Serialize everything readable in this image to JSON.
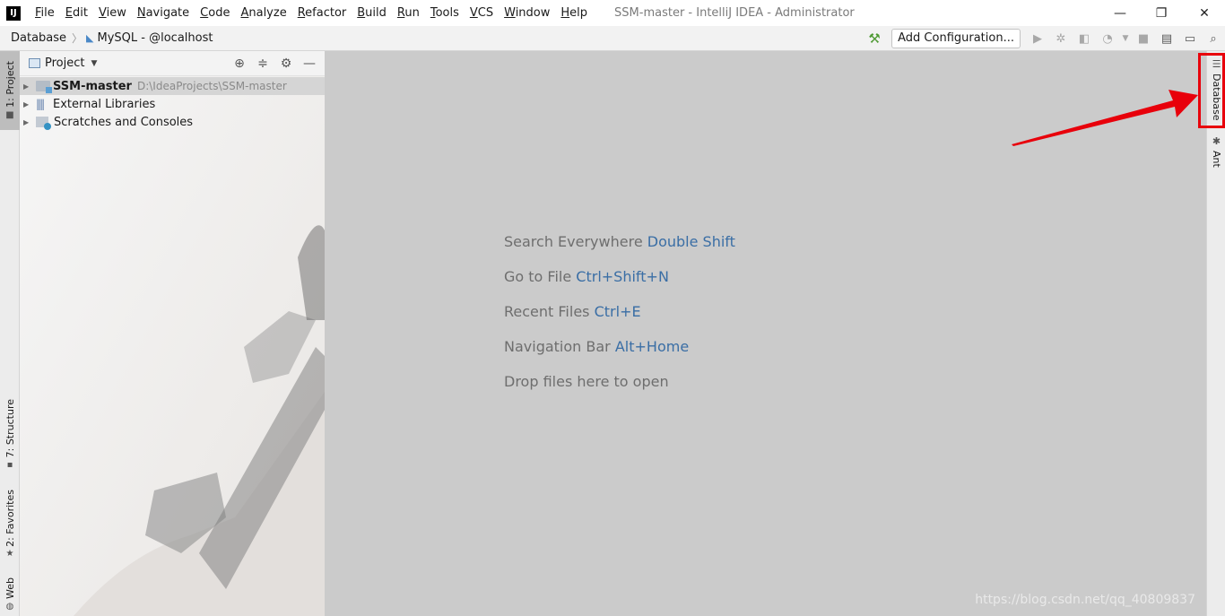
{
  "menubar": {
    "logo": "IJ",
    "items": [
      "File",
      "Edit",
      "View",
      "Navigate",
      "Code",
      "Analyze",
      "Refactor",
      "Build",
      "Run",
      "Tools",
      "VCS",
      "Window",
      "Help"
    ],
    "window_title": "SSM-master - IntelliJ IDEA - Administrator",
    "minimize": "—",
    "restore": "❐",
    "close": "✕"
  },
  "navbar": {
    "crumb_root": "Database",
    "crumb_child": "MySQL - @localhost",
    "add_config_label": "Add Configuration..."
  },
  "left_strip": {
    "tabs": [
      "1: Project",
      "7: Structure",
      "2: Favorites",
      "Web"
    ]
  },
  "project_panel": {
    "title": "Project",
    "tree": [
      {
        "label": "SSM-master",
        "path": "D:\\IdeaProjects\\SSM-master",
        "selected": true
      },
      {
        "label": "External Libraries"
      },
      {
        "label": "Scratches and Consoles"
      }
    ]
  },
  "editor": {
    "hints": [
      {
        "text": "Search Everywhere",
        "key": "Double Shift"
      },
      {
        "text": "Go to File",
        "key": "Ctrl+Shift+N"
      },
      {
        "text": "Recent Files",
        "key": "Ctrl+E"
      },
      {
        "text": "Navigation Bar",
        "key": "Alt+Home"
      },
      {
        "text": "Drop files here to open",
        "key": ""
      }
    ],
    "watermark": "https://blog.csdn.net/qq_40809837"
  },
  "right_strip": {
    "tabs": [
      "Database",
      "Ant"
    ]
  },
  "colors": {
    "annotation_red": "#e8000b",
    "shortcut_blue": "#3a6ea5"
  }
}
